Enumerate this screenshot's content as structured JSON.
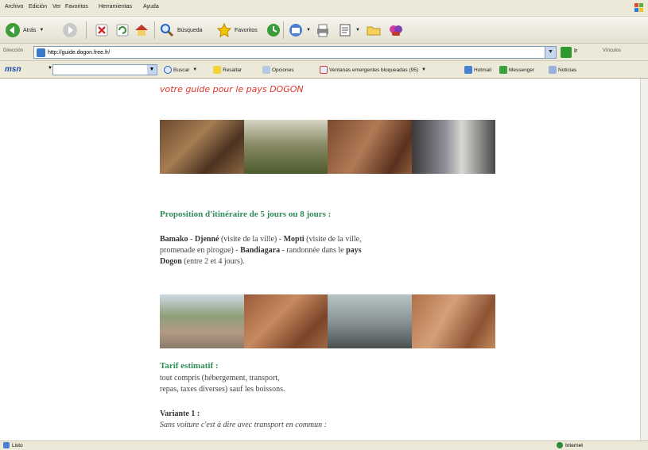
{
  "menu": [
    "Archivo",
    "Edición",
    "Ver",
    "Favoritos",
    "Herramientas",
    "Ayuda"
  ],
  "toolbar": {
    "back_label": "Atrás",
    "search_label": "Búsqueda",
    "favorites_label": "Favoritos"
  },
  "address": {
    "label": "Dirección",
    "url": "http://guide.dogon.free.fr/",
    "go_label": "Ir",
    "links_label": "Vínculos"
  },
  "msn": {
    "logo": "msn",
    "search_label": "Buscar",
    "highlight_label": "Resaltar",
    "options_label": "Opciones",
    "popups_label": "Ventanas emergentes bloqueadas (95)",
    "hotmail_label": "Hotmail",
    "messenger_label": "Messenger",
    "news_label": "Noticias"
  },
  "page": {
    "tagline": "votre guide pour le pays DOGON",
    "itinerary_heading": "Proposition d'itinéraire de 5 jours ou 8 jours :",
    "itinerary": {
      "bamako": "Bamako",
      "sep1": " - ",
      "djenne": "Djenné",
      "djenne_note": " (visite de la ville) - ",
      "mopti": "Mopti",
      "mopti_note": " (visite de la ville, promenade en pirogue) - ",
      "bandiagara": "Bandiagara",
      "bandiagara_note": " - randonnée dans le ",
      "pays_dogon": "pays Dogon",
      "end_note": " (entre 2 et 4 jours)."
    },
    "tarif_heading": "Tarif estimatif :",
    "tarif_text_1": "tout compris (hébergement, transport,",
    "tarif_text_2": "repas, taxes diverses) sauf les boissons.",
    "variante_label": "Variante 1 :",
    "variante_text": "Sans voiture c'est à dire avec transport en commun :"
  },
  "status": {
    "left": "Listo",
    "zone": "Internet"
  }
}
